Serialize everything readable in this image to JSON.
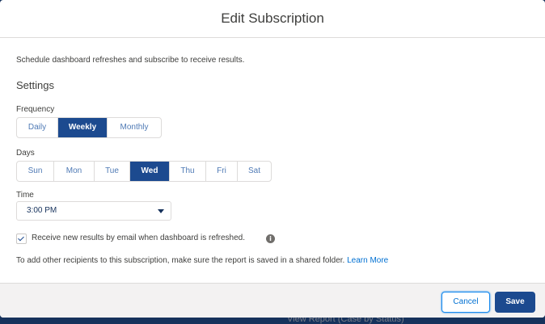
{
  "modal": {
    "title": "Edit Subscription",
    "intro": "Schedule dashboard refreshes and subscribe to receive results.",
    "settings_title": "Settings",
    "frequency": {
      "label": "Frequency",
      "options": [
        "Daily",
        "Weekly",
        "Monthly"
      ],
      "selected": "Weekly"
    },
    "days": {
      "label": "Days",
      "options": [
        "Sun",
        "Mon",
        "Tue",
        "Wed",
        "Thu",
        "Fri",
        "Sat"
      ],
      "selected": "Wed"
    },
    "time": {
      "label": "Time",
      "value": "3:00 PM"
    },
    "email_checkbox": {
      "label": "Receive new results by email when dashboard is refreshed.",
      "checked": true
    },
    "footnote": "To add other recipients to this subscription, make sure the report is saved in a shared folder.",
    "learn_more": "Learn More",
    "cancel_label": "Cancel",
    "save_label": "Save"
  },
  "backdrop": {
    "text": "View Report (Case by Status)"
  },
  "colors": {
    "accent": "#1c4a8f",
    "link": "#0070d2",
    "backdrop": "#16325c"
  }
}
